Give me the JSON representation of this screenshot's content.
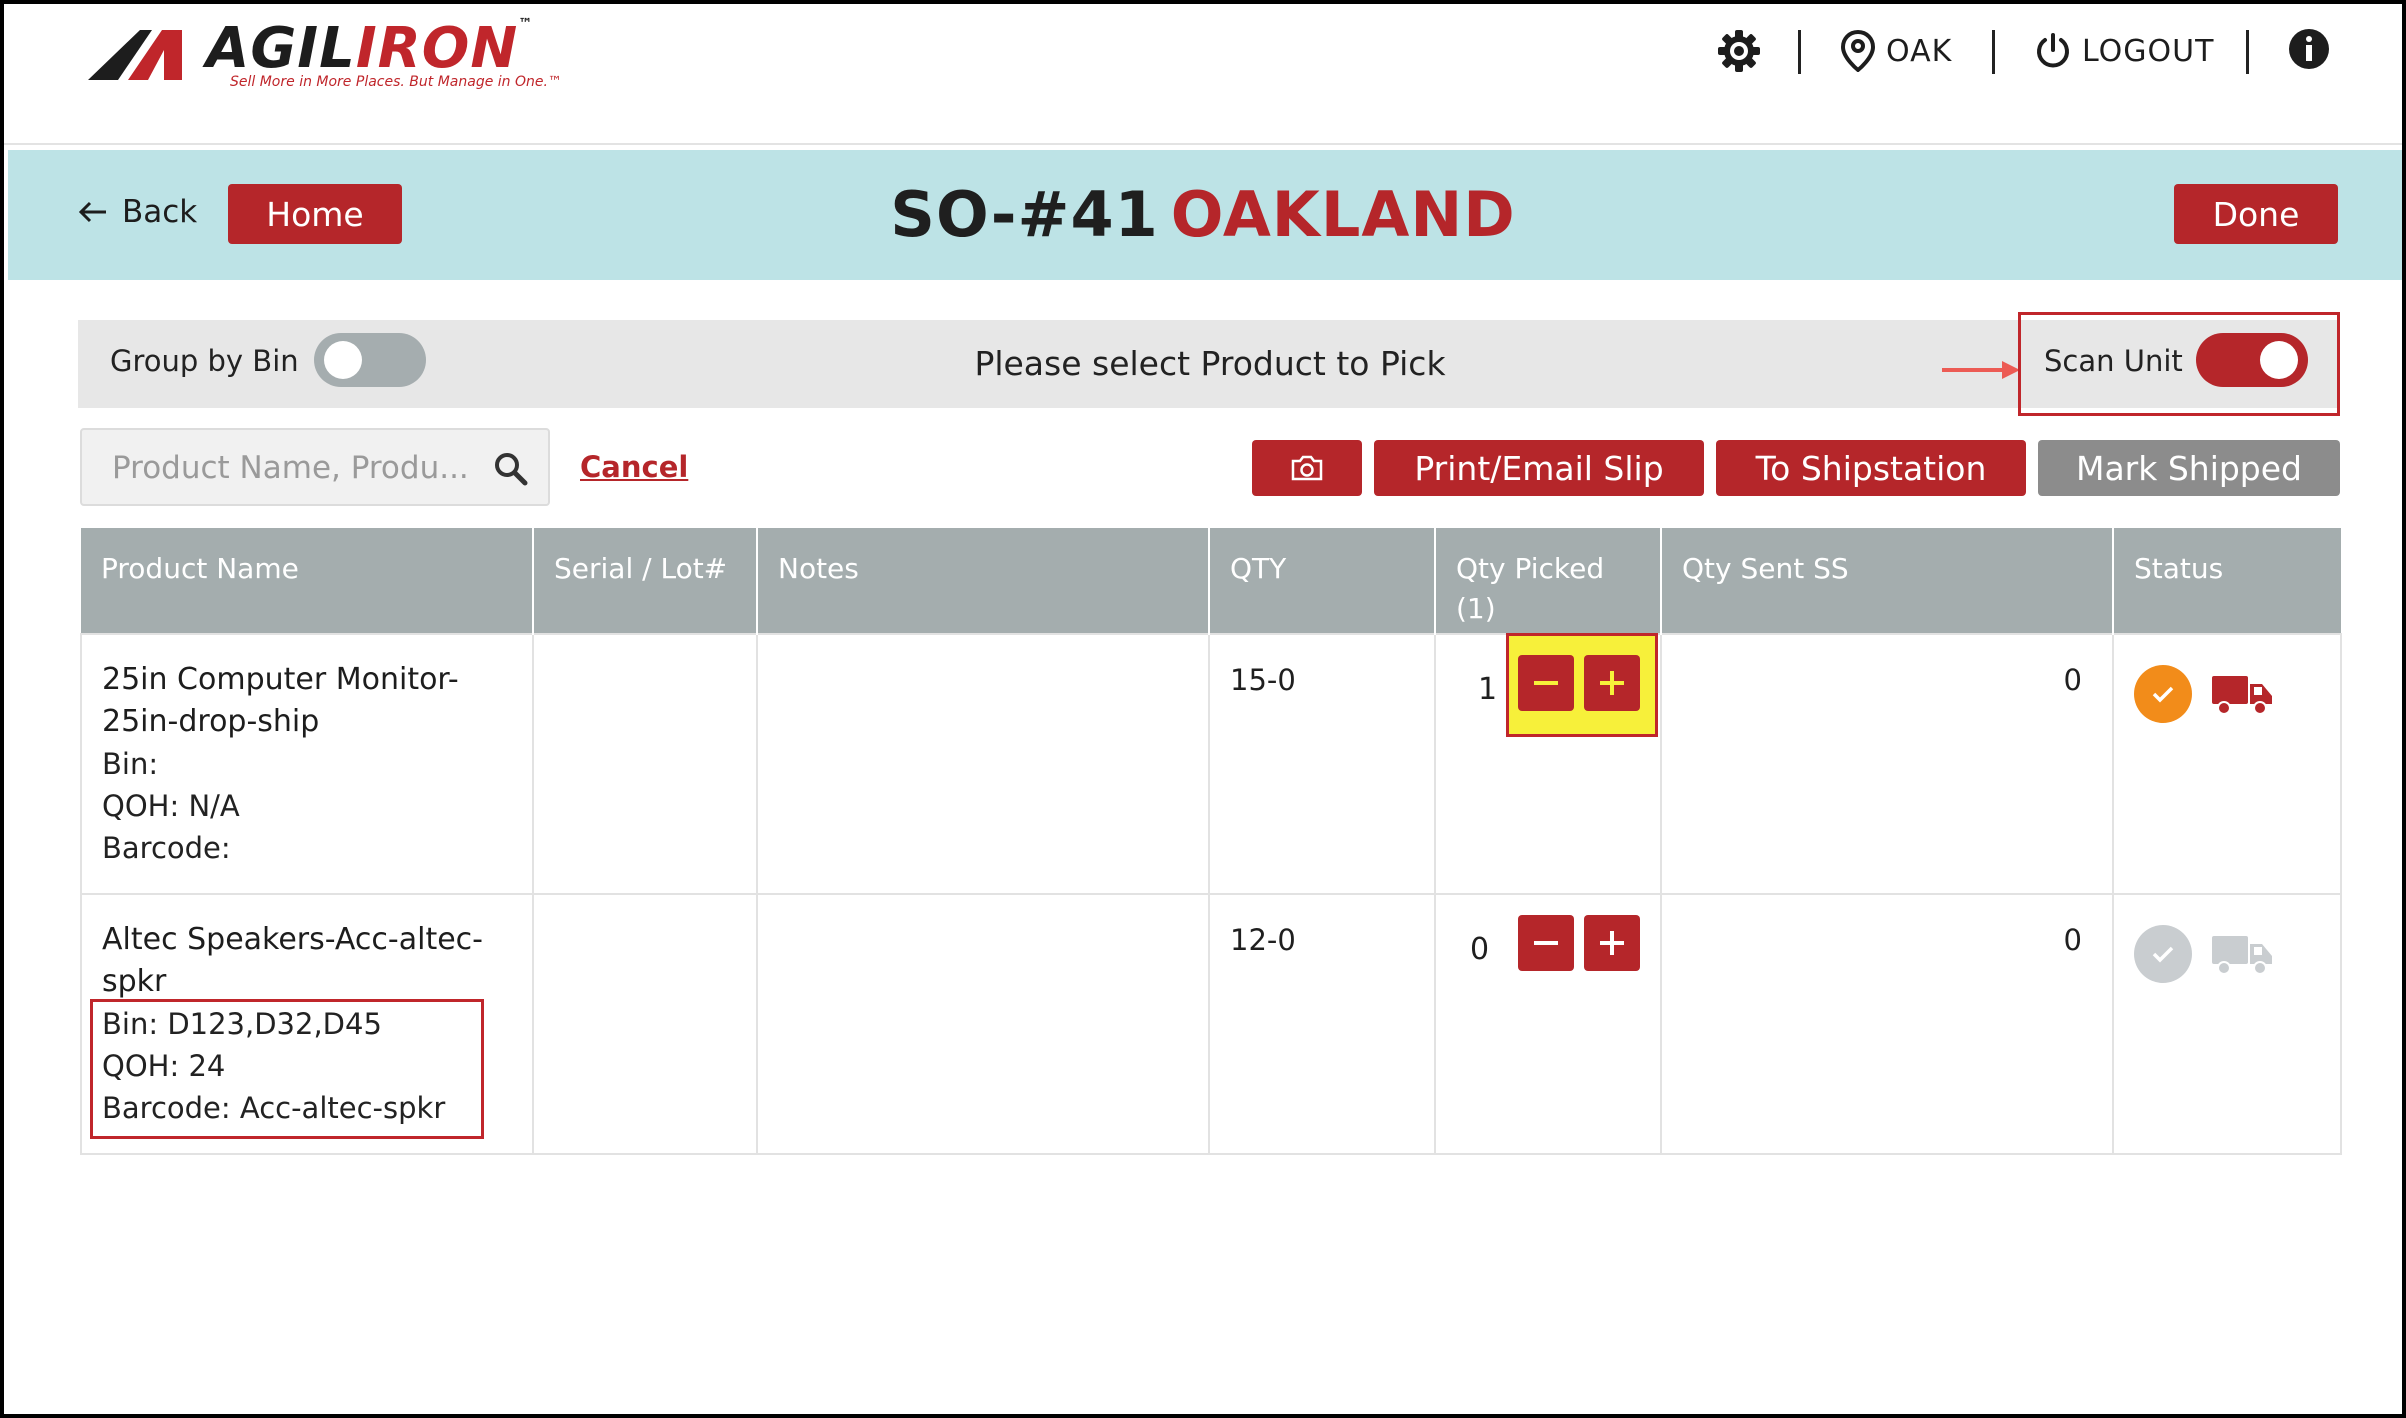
{
  "brand": {
    "name_dark": "AGIL",
    "name_red": "IRON",
    "trademark": "™",
    "tagline": "Sell More in More Places. But Manage in One.™"
  },
  "topnav": {
    "location": "OAK",
    "logout": "LOGOUT"
  },
  "header": {
    "back_label": "Back",
    "home_label": "Home",
    "order_number": "SO-#41",
    "location_name": "OAKLAND",
    "done_label": "Done"
  },
  "toolbar": {
    "group_by_bin_label": "Group by Bin",
    "group_by_bin_on": false,
    "prompt": "Please select Product to Pick",
    "scan_unit_label": "Scan Unit",
    "scan_unit_on": true
  },
  "search": {
    "placeholder": "Product Name, Produ...",
    "value": "",
    "cancel_label": "Cancel"
  },
  "actions": {
    "print_email": "Print/Email Slip",
    "to_shipstation": "To Shipstation",
    "mark_shipped": "Mark Shipped"
  },
  "table": {
    "headers": {
      "product_name": "Product Name",
      "serial_lot": "Serial / Lot#",
      "notes": "Notes",
      "qty": "QTY",
      "qty_picked": "Qty Picked",
      "qty_picked_count": "(1)",
      "qty_sent_ss": "Qty Sent SS",
      "status": "Status"
    },
    "rows": [
      {
        "name": "25in Computer Monitor-25in-drop-ship",
        "bin": "Bin:",
        "qoh": "QOH: N/A",
        "barcode": "Barcode:",
        "serial": "",
        "notes": "",
        "qty": "15-0",
        "qty_picked": "1",
        "qty_sent": "0",
        "status": "picked"
      },
      {
        "name": "Altec Speakers-Acc-altec-spkr",
        "bin": "Bin: D123,D32,D45",
        "qoh": "QOH: 24",
        "barcode": "Barcode: Acc-altec-spkr",
        "serial": "",
        "notes": "",
        "qty": "12-0",
        "qty_picked": "0",
        "qty_sent": "0",
        "status": "pending"
      }
    ]
  },
  "colors": {
    "brand_red": "#b5262a",
    "band_bg": "#bde3e6",
    "header_gray": "#a4adae",
    "status_orange": "#f28c1a",
    "status_inactive": "#c9cdd0",
    "highlight_yellow": "#f7f03a"
  },
  "icons": [
    "gear-icon",
    "location-pin-icon",
    "power-icon",
    "info-icon",
    "back-arrow-icon",
    "search-icon",
    "camera-icon",
    "minus-icon",
    "plus-icon",
    "check-icon",
    "truck-icon",
    "arrow-right-icon"
  ]
}
